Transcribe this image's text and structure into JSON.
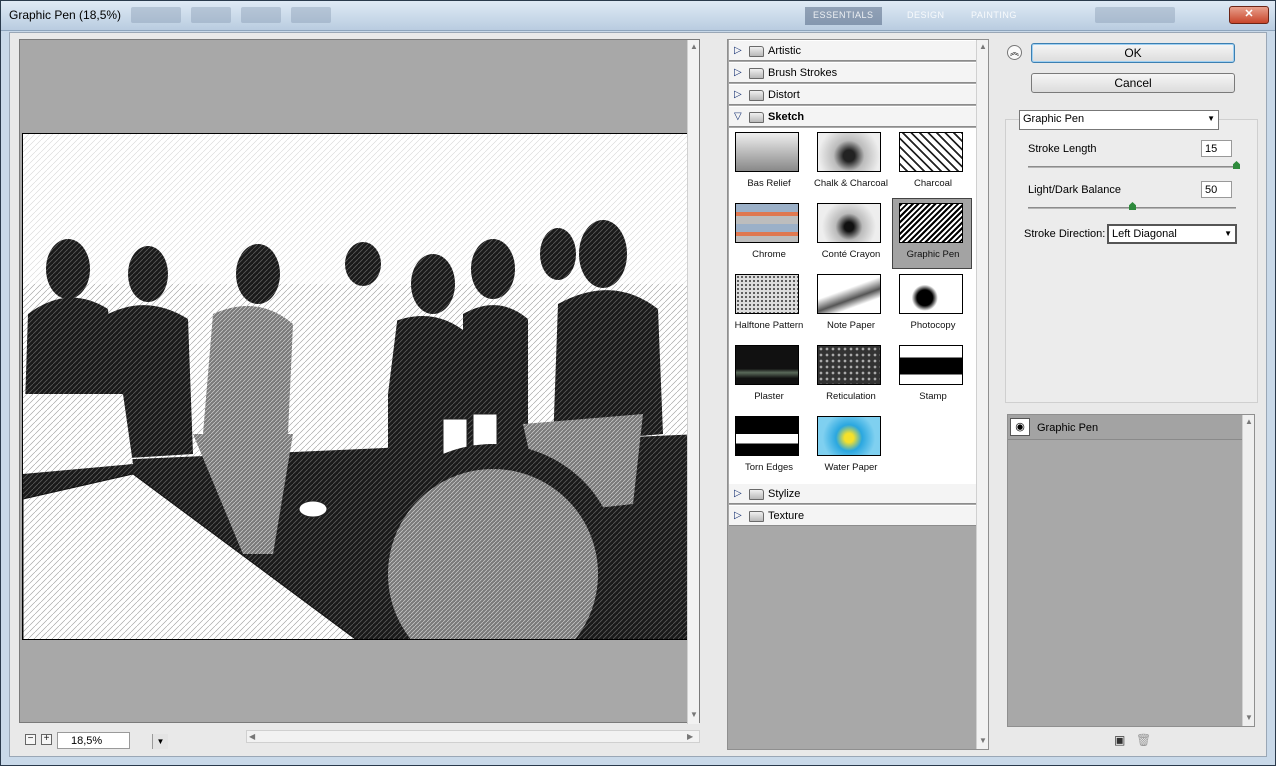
{
  "window": {
    "title": "Graphic Pen (18,5%)"
  },
  "titlebar_tabs": [
    "ESSENTIALS",
    "DESIGN",
    "PAINTING"
  ],
  "preview": {
    "zoom": "18,5%"
  },
  "gallery": {
    "categories_top": [
      "Artistic",
      "Brush Strokes",
      "Distort"
    ],
    "open_category": "Sketch",
    "categories_bottom": [
      "Stylize",
      "Texture"
    ],
    "thumbnails": [
      {
        "label": "Bas Relief"
      },
      {
        "label": "Chalk & Charcoal"
      },
      {
        "label": "Charcoal"
      },
      {
        "label": "Chrome"
      },
      {
        "label": "Conté Crayon"
      },
      {
        "label": "Graphic Pen"
      },
      {
        "label": "Halftone Pattern"
      },
      {
        "label": "Note Paper"
      },
      {
        "label": "Photocopy"
      },
      {
        "label": "Plaster"
      },
      {
        "label": "Reticulation"
      },
      {
        "label": "Stamp"
      },
      {
        "label": "Torn Edges"
      },
      {
        "label": "Water Paper"
      }
    ],
    "selected_thumbnail": "Graphic Pen"
  },
  "buttons": {
    "ok": "OK",
    "cancel": "Cancel"
  },
  "settings": {
    "filter": "Graphic Pen",
    "stroke_length_label": "Stroke Length",
    "stroke_length_value": "15",
    "stroke_length_max": 15,
    "balance_label": "Light/Dark Balance",
    "balance_value": "50",
    "balance_max": 100,
    "direction_label": "Stroke Direction:",
    "direction_value": "Left Diagonal"
  },
  "layers": {
    "items": [
      "Graphic Pen"
    ]
  },
  "icons": {
    "collapse": "collapse-up-icon",
    "eye": "eye-icon",
    "new_layer": "new-layer-icon",
    "trash": "trash-icon"
  }
}
